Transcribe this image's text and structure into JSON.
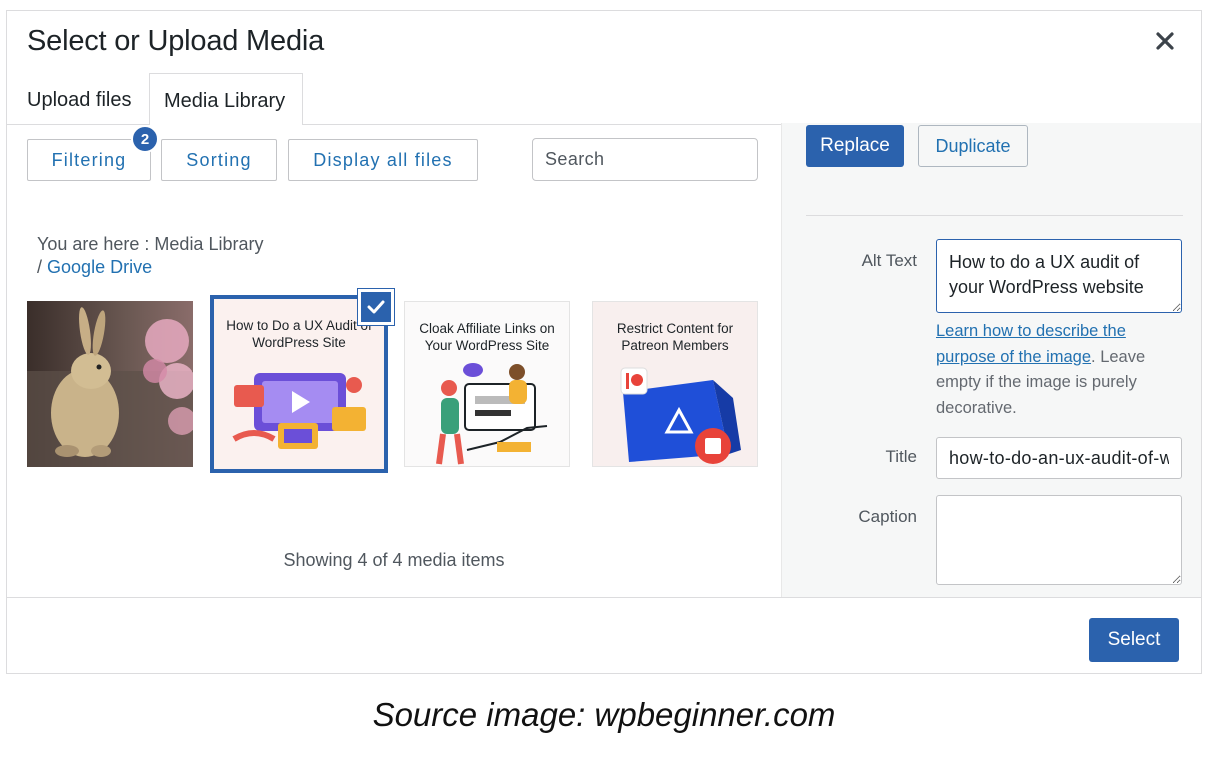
{
  "modal": {
    "title": "Select or Upload Media"
  },
  "tabs": [
    {
      "label": "Upload files",
      "active": false
    },
    {
      "label": "Media Library",
      "active": true
    }
  ],
  "toolbar": {
    "filtering_label": "Filtering",
    "filter_count": "2",
    "sorting_label": "Sorting",
    "display_label": "Display all files",
    "search_placeholder": "Search"
  },
  "breadcrumb": {
    "prefix": "You are here  :  Media Library",
    "separator": "/",
    "current": "Google Drive"
  },
  "media_items": [
    {
      "caption": "",
      "selected": false
    },
    {
      "caption": "How to Do a UX Audit of WordPress Site",
      "selected": true
    },
    {
      "caption": "Cloak Affiliate Links on Your WordPress Site",
      "selected": false
    },
    {
      "caption": "Restrict Content for Patreon Members",
      "selected": false
    }
  ],
  "status": {
    "showing": "Showing 4 of 4 media items"
  },
  "sidebar": {
    "replace_label": "Replace",
    "duplicate_label": "Duplicate",
    "alt_label": "Alt Text",
    "alt_value": "How to do a UX audit of your WordPress website",
    "help_link": "Learn how to describe the purpose of the image",
    "help_text": ". Leave empty if the image is purely decorative.",
    "title_label": "Title",
    "title_value": "how-to-do-an-ux-audit-of-wordpress-site",
    "caption_label": "Caption",
    "caption_value": ""
  },
  "footer": {
    "select_label": "Select"
  },
  "source_note": "Source image: wpbeginner.com",
  "colors": {
    "primary": "#2b62ad",
    "link": "#2271b1",
    "border": "#c3c4c7",
    "sidebar_bg": "#f6f7f7"
  },
  "icons": [
    "close-icon",
    "checkmark-icon"
  ]
}
